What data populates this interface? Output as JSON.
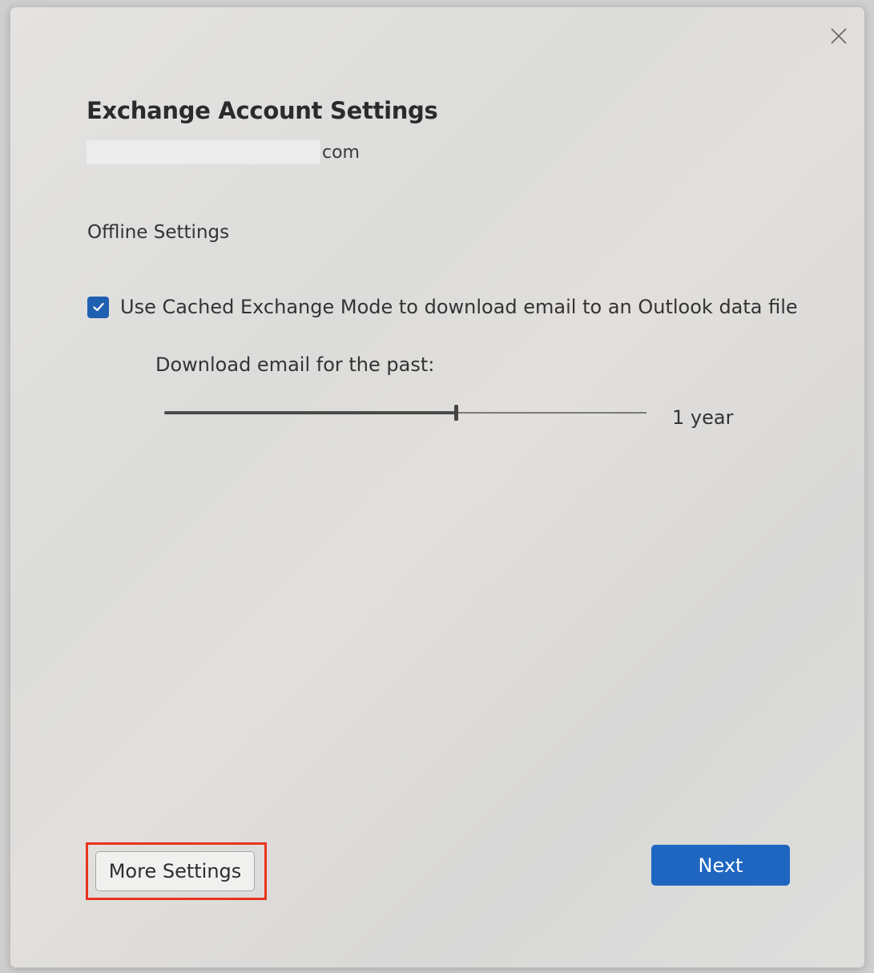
{
  "dialog": {
    "title": "Exchange Account Settings",
    "email_suffix": "com"
  },
  "offline": {
    "heading": "Offline Settings",
    "cached_mode": {
      "label": "Use Cached Exchange Mode to download email to an Outlook data file",
      "checked": true
    },
    "download": {
      "label": "Download email for the past:",
      "value_label": "1 year",
      "slider_fraction": 0.605
    }
  },
  "buttons": {
    "more_settings": "More Settings",
    "next": "Next"
  },
  "icons": {
    "close": "close-icon",
    "checkmark": "checkmark-icon"
  },
  "colors": {
    "accent": "#1f66c1",
    "checkbox": "#1f5fb0",
    "highlight": "#e8341f"
  }
}
